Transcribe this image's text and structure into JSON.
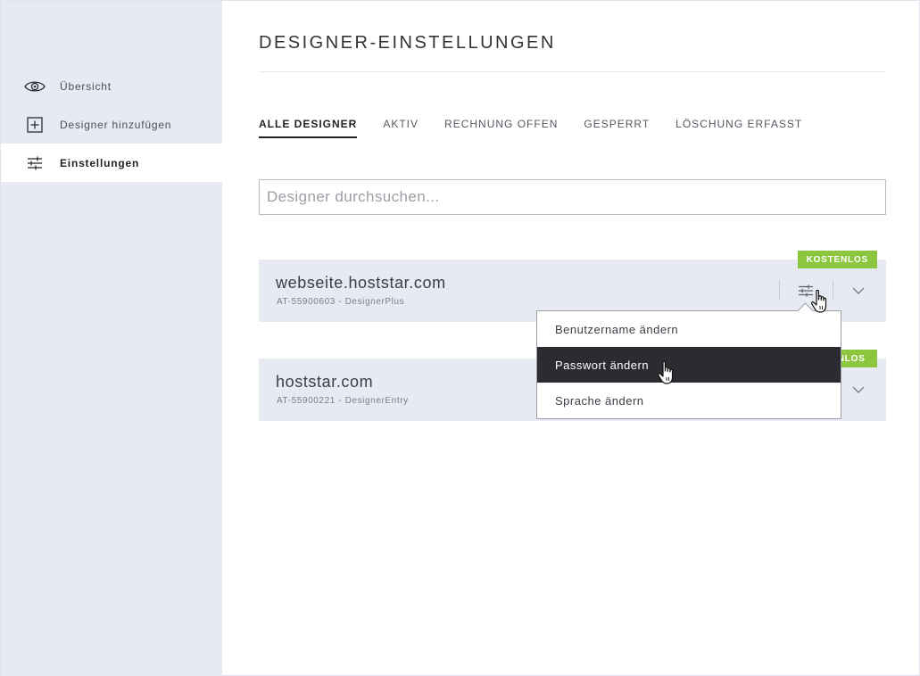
{
  "sidebar": {
    "items": [
      {
        "label": "Übersicht",
        "icon": "eye-icon"
      },
      {
        "label": "Designer hinzufügen",
        "icon": "plus-square-icon"
      },
      {
        "label": "Einstellungen",
        "icon": "sliders-icon",
        "active": true
      }
    ]
  },
  "main": {
    "title": "DESIGNER-EINSTELLUNGEN",
    "tabs": [
      {
        "label": "ALLE DESIGNER",
        "active": true
      },
      {
        "label": "AKTIV"
      },
      {
        "label": "RECHNUNG OFFEN"
      },
      {
        "label": "GESPERRT"
      },
      {
        "label": "LÖSCHUNG ERFASST"
      }
    ],
    "search": {
      "placeholder": "Designer durchsuchen...",
      "value": ""
    },
    "designers": [
      {
        "domain": "webseite.hoststar.com",
        "meta": "AT-55900603 - DesignerPlus",
        "badge": "KOSTENLOS"
      },
      {
        "domain": "hoststar.com",
        "meta": "AT-55900221 - DesignerEntry",
        "badge": "KOSTENLOS"
      }
    ]
  },
  "dropdown": {
    "items": [
      {
        "label": "Benutzername ändern"
      },
      {
        "label": "Passwort ändern",
        "selected": true
      },
      {
        "label": "Sprache ändern"
      }
    ]
  },
  "colors": {
    "sidebar_bg": "#e7eaf3",
    "badge_green": "#8cc63f",
    "selected_item_bg": "#2b2c31"
  }
}
